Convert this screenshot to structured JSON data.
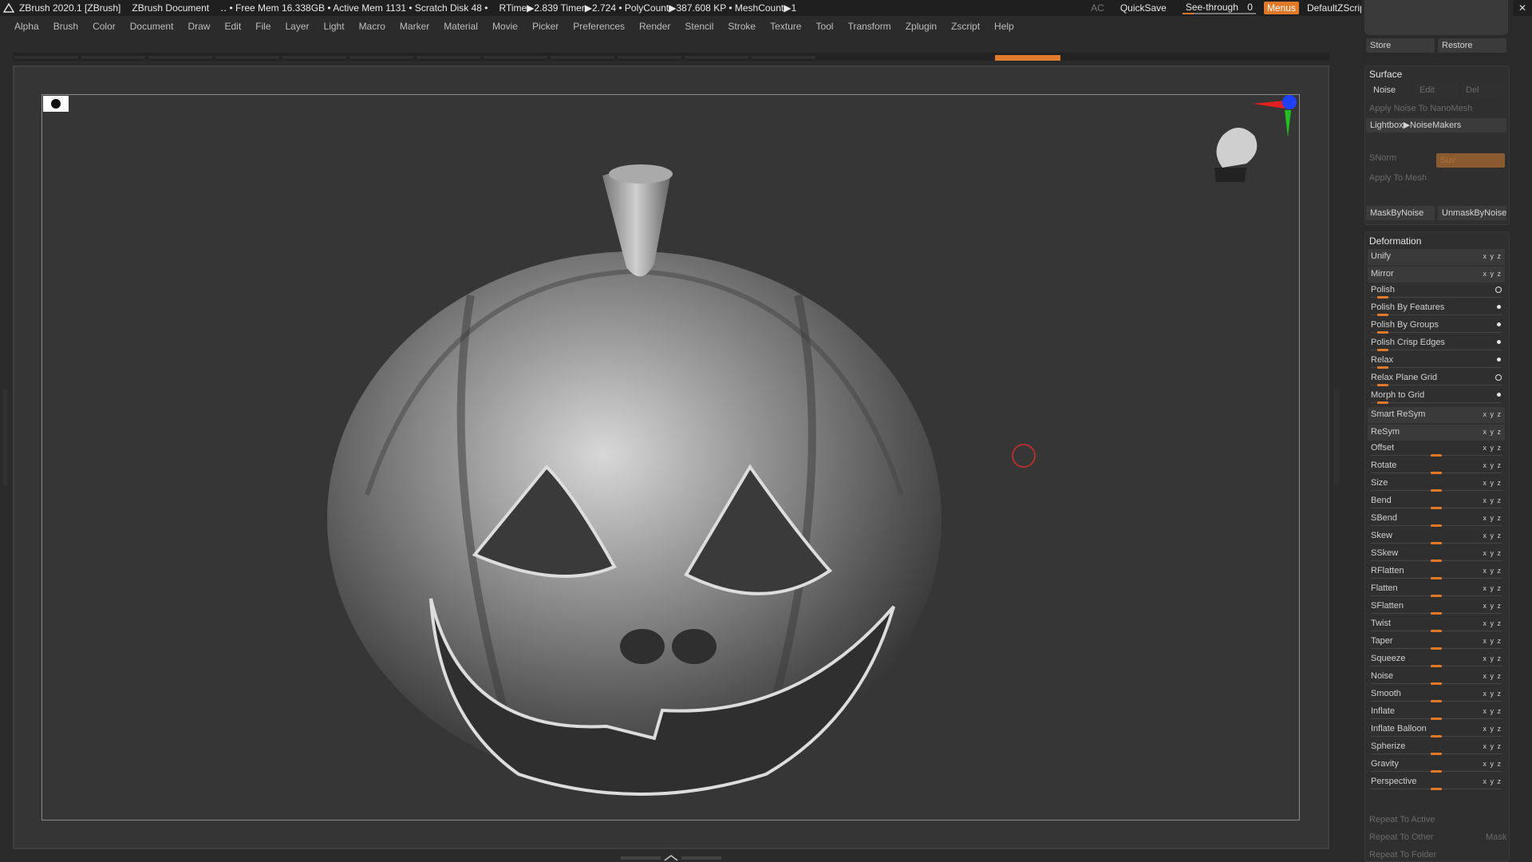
{
  "titlebar": {
    "app": "ZBrush 2020.1 [ZBrush]",
    "doc": "ZBrush Document",
    "stats": "‥ • Free Mem 16.338GB • Active Mem 1131 • Scratch Disk 48 •",
    "timers": "RTime▶2.839 Timer▶2.724 • PolyCount▶387.608 KP • MeshCount▶1",
    "ac": "AC",
    "quicksave": "QuickSave",
    "see_through_label": "See-through",
    "see_through_value": "0",
    "menus": "Menus",
    "script": "DefaultZScript"
  },
  "menubar": [
    "Alpha",
    "Brush",
    "Color",
    "Document",
    "Draw",
    "Edit",
    "File",
    "Layer",
    "Light",
    "Macro",
    "Marker",
    "Material",
    "Movie",
    "Picker",
    "Preferences",
    "Render",
    "Stencil",
    "Stroke",
    "Texture",
    "Tool",
    "Transform",
    "Zplugin",
    "Zscript",
    "Help"
  ],
  "panel": {
    "store": "Store",
    "restore": "Restore",
    "surface": {
      "title": "Surface",
      "noise": "Noise",
      "edit": "Edit",
      "del": "Del",
      "apply_noise_nano": "Apply Noise To NanoMesh",
      "lightbox": "Lightbox▶NoiseMakers",
      "snorm": "SNorm",
      "suv": "Suv",
      "apply_mesh": "Apply To Mesh",
      "mask_by_noise": "MaskByNoise",
      "unmask_by_noise": "UnmaskByNoise"
    },
    "deformation": {
      "title": "Deformation",
      "unify": "Unify",
      "mirror": "Mirror",
      "polish_items": [
        {
          "label": "Polish",
          "level": 0.05
        },
        {
          "label": "Polish By Features",
          "level": 0.05
        },
        {
          "label": "Polish By Groups",
          "level": 0.05
        },
        {
          "label": "Polish Crisp Edges",
          "level": 0.05
        },
        {
          "label": "Relax",
          "level": 0.05
        },
        {
          "label": "Relax Plane Grid",
          "level": 0.05
        },
        {
          "label": "Morph to Grid",
          "level": 0.05
        }
      ],
      "smart_resym": "Smart ReSym",
      "resym": "ReSym",
      "sliders": [
        {
          "label": "Offset",
          "level": 0.5
        },
        {
          "label": "Rotate",
          "level": 0.5
        },
        {
          "label": "Size",
          "level": 0.5
        },
        {
          "label": "Bend",
          "level": 0.5
        },
        {
          "label": "SBend",
          "level": 0.5
        },
        {
          "label": "Skew",
          "level": 0.5
        },
        {
          "label": "SSkew",
          "level": 0.5
        },
        {
          "label": "RFlatten",
          "level": 0.5
        },
        {
          "label": "Flatten",
          "level": 0.5
        },
        {
          "label": "SFlatten",
          "level": 0.5
        },
        {
          "label": "Twist",
          "level": 0.5
        },
        {
          "label": "Taper",
          "level": 0.5
        },
        {
          "label": "Squeeze",
          "level": 0.5
        },
        {
          "label": "Noise",
          "level": 0.5
        },
        {
          "label": "Smooth",
          "level": 0.5
        },
        {
          "label": "Inflate",
          "level": 0.5
        },
        {
          "label": "Inflate Balloon",
          "level": 0.5
        },
        {
          "label": "Spherize",
          "level": 0.5
        },
        {
          "label": "Gravity",
          "level": 0.5
        },
        {
          "label": "Perspective",
          "level": 0.5
        }
      ],
      "repeat_active": "Repeat To Active",
      "repeat_other": "Repeat To Other",
      "mask": "Mask",
      "repeat_folder": "Repeat To Folder"
    }
  },
  "colors": {
    "accent": "#e07a2a",
    "brush_ring": "#b03030"
  }
}
